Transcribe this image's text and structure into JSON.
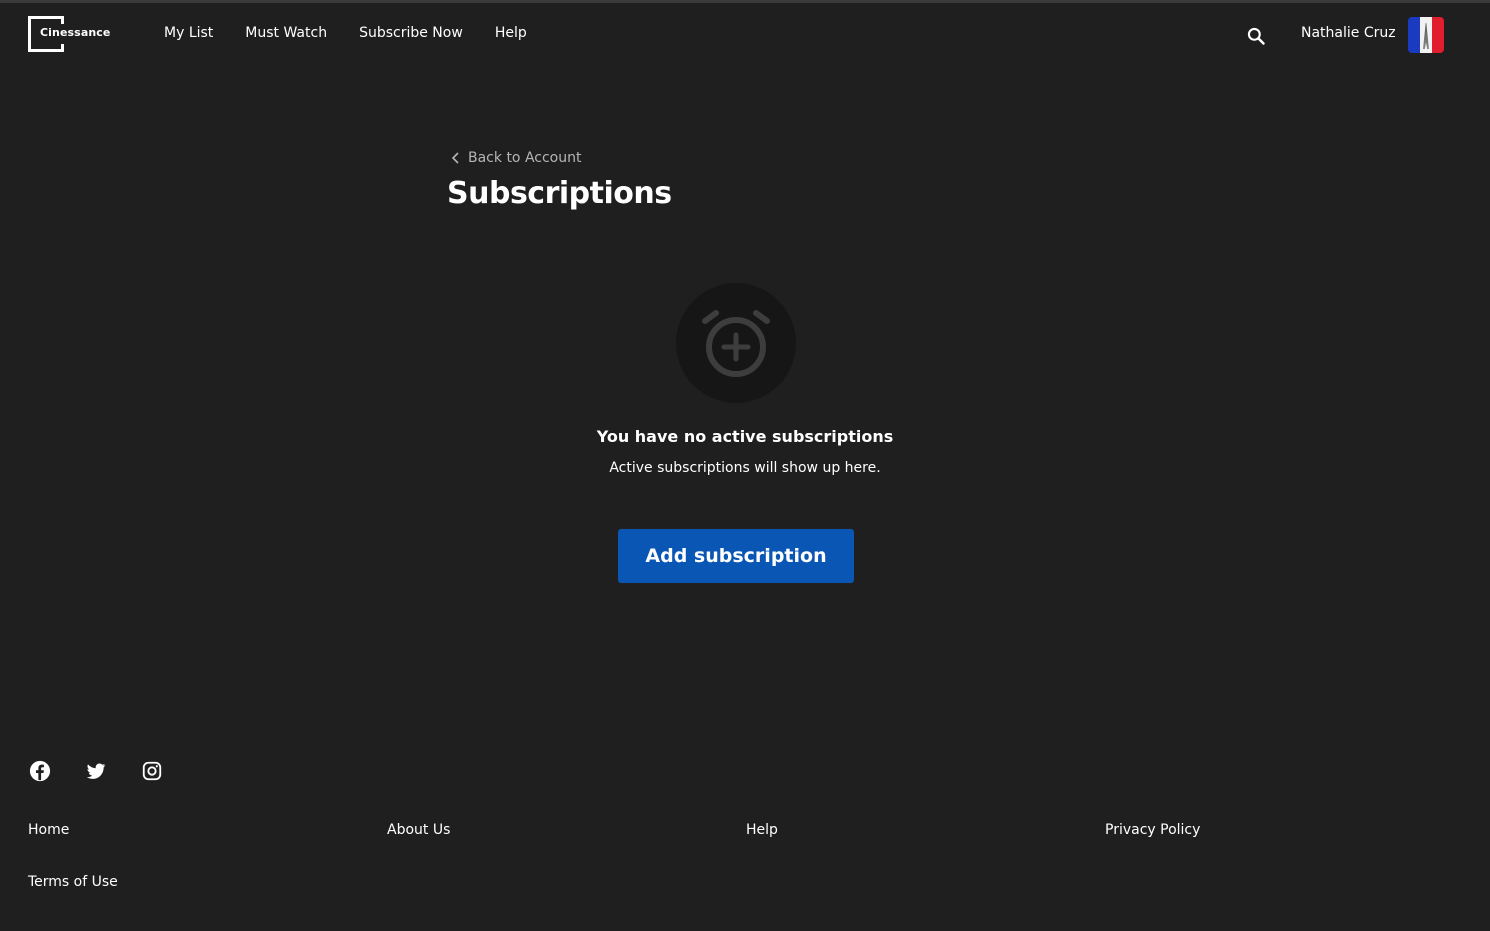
{
  "header": {
    "logo_text": "Cinessance",
    "nav": [
      "My List",
      "Must Watch",
      "Subscribe Now",
      "Help"
    ],
    "user_name": "Nathalie Cruz"
  },
  "main": {
    "back_label": "Back to Account",
    "title": "Subscriptions",
    "empty_title": "You have no active subscriptions",
    "empty_subtitle": "Active subscriptions will show up here.",
    "add_button_label": "Add subscription"
  },
  "footer": {
    "social": [
      "facebook-icon",
      "twitter-icon",
      "instagram-icon"
    ],
    "links": [
      "Home",
      "About Us",
      "Help",
      "Privacy Policy",
      "Terms of Use"
    ]
  },
  "colors": {
    "background": "#1f1f1f",
    "primary_button": "#0a56b4",
    "muted_text": "#b5b5b5"
  }
}
